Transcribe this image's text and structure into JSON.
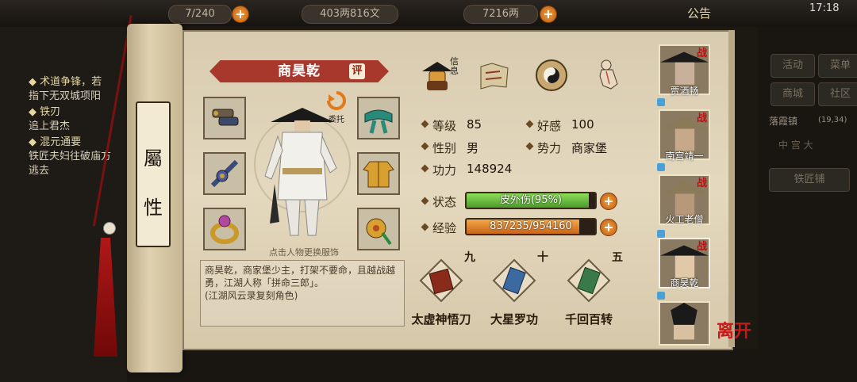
{
  "topbar": {
    "res1": "7/240",
    "money": "403两816文",
    "silver": "7216两",
    "announce": "公告",
    "clock": "17:18"
  },
  "quests": [
    {
      "title": "◆ 术道争锋，若",
      "desc": "指下无双城项阳"
    },
    {
      "title": "◆ 铁刃",
      "desc": "追上君杰"
    },
    {
      "title": "◆ 混元通要",
      "desc": "铁匠夫妇往破庙方"
    },
    {
      "title": "",
      "desc": "逃去"
    }
  ],
  "right_menu": {
    "activity": "活动",
    "menu": "菜单",
    "shop": "商城",
    "community": "社区",
    "location": "落霞镇",
    "coords": "(19,34)",
    "tab": "中 宫 大",
    "smithy": "铁匠铺"
  },
  "scroll_title": [
    "屬",
    "性"
  ],
  "character": {
    "name": "商昊乾",
    "rate": "评",
    "entrust": "委托",
    "swap_hint": "点击人物更换服饰",
    "description": "商昊乾，商家堡少主，打架不要命，且越战越勇，江湖人称「拼命三郎」。",
    "note": "(江湖风云录复刻角色)"
  },
  "top_icons": {
    "info": "信息"
  },
  "stats": {
    "level_label": "等级",
    "level": "85",
    "favor_label": "好感",
    "favor": "100",
    "gender_label": "性别",
    "gender": "男",
    "faction_label": "势力",
    "faction": "商家堡",
    "power_label": "功力",
    "power": "148924",
    "status_label": "状态",
    "status": "皮外伤(95%)",
    "status_fraction": 0.95,
    "exp_label": "经验",
    "exp": "837235/954160",
    "exp_fraction": 0.8775
  },
  "skills": [
    {
      "name": "太虚神悟刀",
      "count": "九"
    },
    {
      "name": "大星罗功",
      "count": "十"
    },
    {
      "name": "千回百转",
      "count": "五"
    }
  ],
  "roster": [
    {
      "name": "贾酒畅",
      "tag": "战"
    },
    {
      "name": "南宫靖一",
      "tag": "战"
    },
    {
      "name": "火工老僧",
      "tag": "战"
    },
    {
      "name": "商昊乾",
      "tag": "战"
    },
    {
      "name": "",
      "tag": ""
    }
  ],
  "leave": "离开",
  "colors": {
    "banner": "#a8372c",
    "status_bar": "#6fc23a",
    "exp_bar": "#e88a28",
    "accent_red": "#c01010"
  }
}
